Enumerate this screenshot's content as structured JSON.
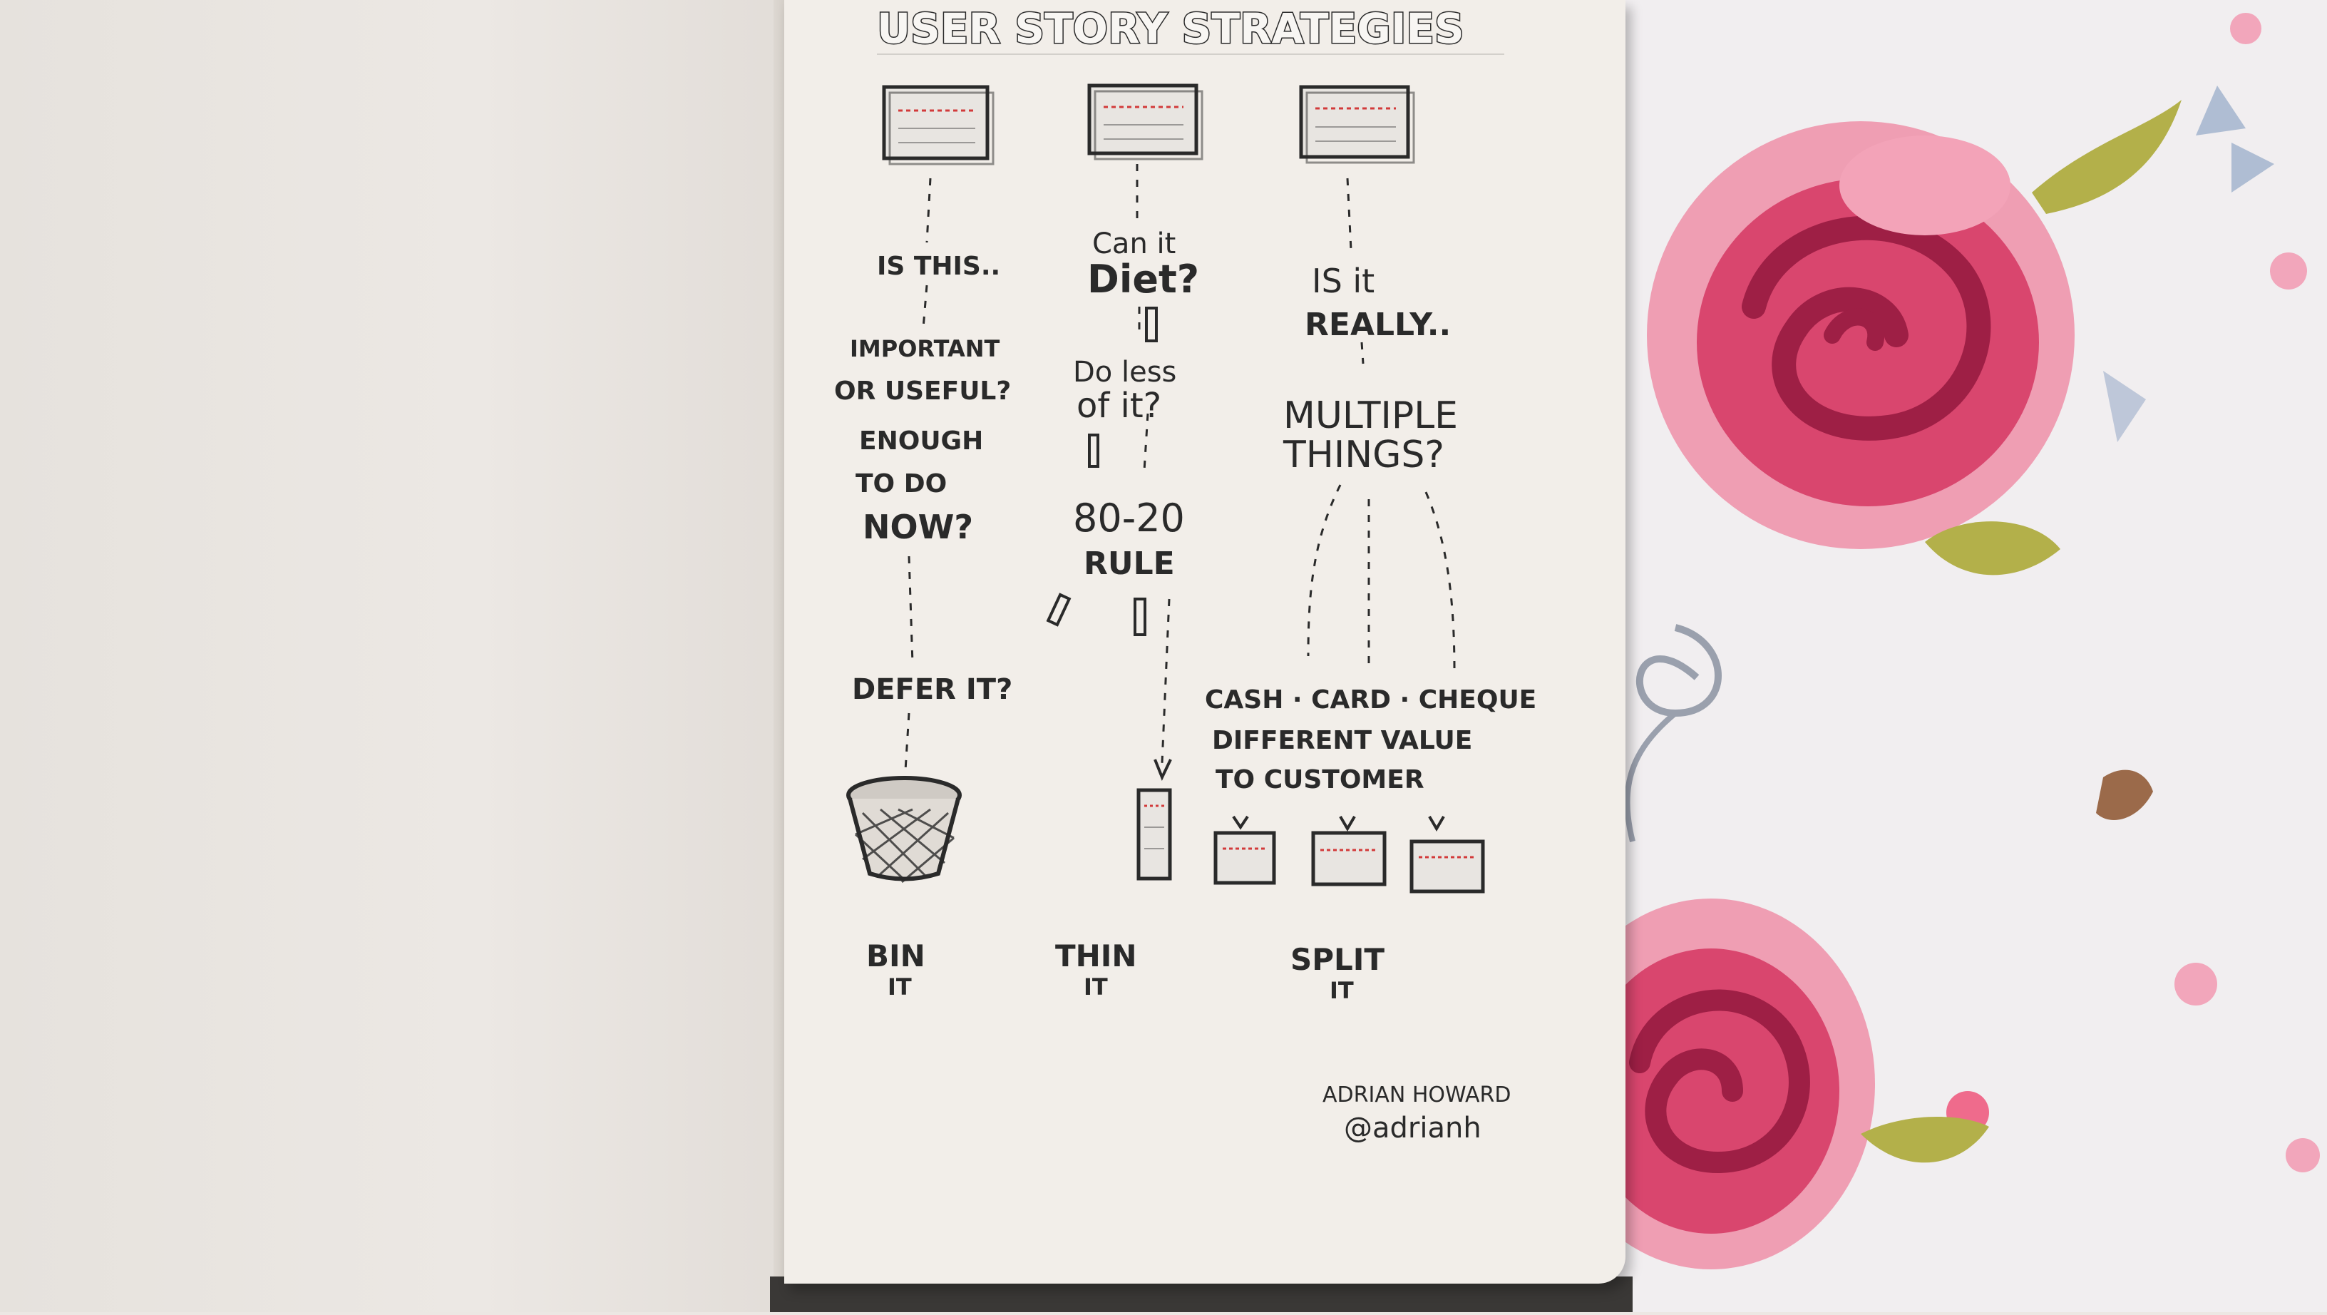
{
  "title": "USER STORY STRATEGIES",
  "columns": [
    {
      "questions": [
        "IS THIS..",
        "IMPORTANT",
        "OR USEFUL?",
        "ENOUGH",
        "TO DO",
        "NOW?"
      ],
      "action_question": "DEFER IT?",
      "result_line1": "BIN",
      "result_line2": "IT"
    },
    {
      "questions": [
        "Can it",
        "Diet?",
        "Do less",
        "of it?",
        "80-20",
        "RULE"
      ],
      "result_line1": "THIN",
      "result_line2": "IT"
    },
    {
      "questions": [
        "IS it",
        "REALLY..",
        "MULTIPLE",
        "THINGS?"
      ],
      "split_notes": [
        "CASH · CARD · CHEQUE",
        "DIFFERENT VALUE",
        "TO CUSTOMER"
      ],
      "result_line1": "SPLIT",
      "result_line2": "IT"
    }
  ],
  "signature": {
    "name": "ADRIAN HOWARD",
    "handle": "@adrianh"
  },
  "colors": {
    "ink": "#2a2a2a",
    "card_red_line": "#d23a3a",
    "page": "#f2eee9",
    "rose": "#d9466e",
    "leaf": "#b3b04a"
  }
}
